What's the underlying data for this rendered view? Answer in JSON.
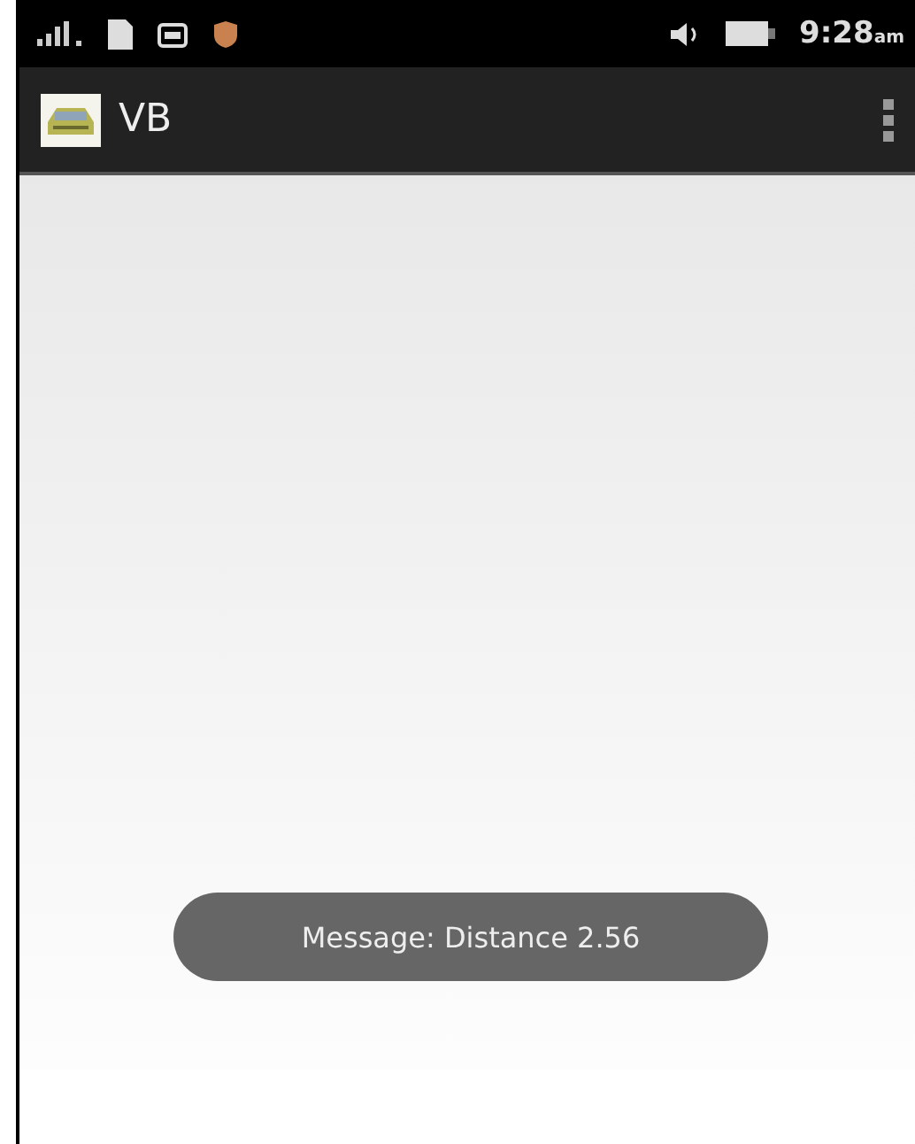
{
  "status_bar": {
    "time": "9:28",
    "time_suffix": "am"
  },
  "action_bar": {
    "title": "VB"
  },
  "toast": {
    "message": "Message: Distance 2.56"
  }
}
